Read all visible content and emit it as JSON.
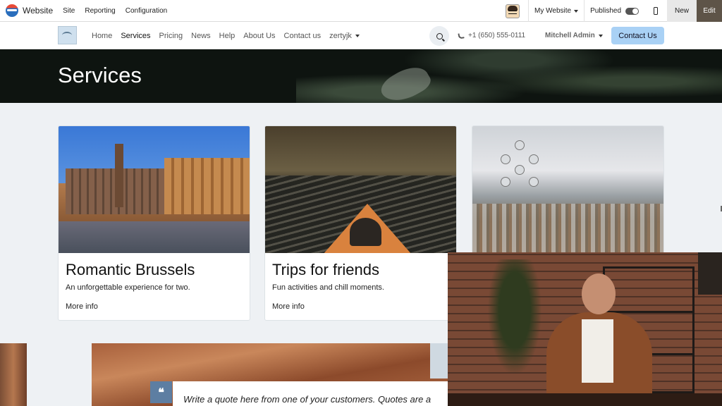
{
  "admin": {
    "app_title": "Website",
    "menu": [
      "Site",
      "Reporting",
      "Configuration"
    ],
    "site_switcher": "My Website",
    "published_label": "Published",
    "new_label": "New",
    "edit_label": "Edit"
  },
  "nav": {
    "links": [
      "Home",
      "Services",
      "Pricing",
      "News",
      "Help",
      "About Us",
      "Contact us"
    ],
    "dropdown": "zertyjk",
    "active": "Services",
    "phone": "+1 (650) 555-0111",
    "user": "Mitchell Admin",
    "cta": "Contact Us"
  },
  "hero": {
    "title": "Services"
  },
  "cards": [
    {
      "title": "Romantic Brussels",
      "text": "An unforgettable experience for two.",
      "link": "More info"
    },
    {
      "title": "Trips for friends",
      "text": "Fun activities and chill moments.",
      "link": "More info"
    },
    {
      "title": "",
      "text": "",
      "link": ""
    }
  ],
  "quote": {
    "icon_glyph": "❝",
    "text": "Write a quote here from one of your customers. Quotes are a"
  },
  "icons": {
    "app": "website-globe-icon",
    "search": "search-icon",
    "phone": "phone-icon",
    "mobile": "mobile-preview-icon",
    "quote": "quote-icon"
  },
  "colors": {
    "cta_bg": "#a9d1f5",
    "edit_bg": "#5e5448",
    "quote_icon_bg": "#5d7ea2"
  }
}
